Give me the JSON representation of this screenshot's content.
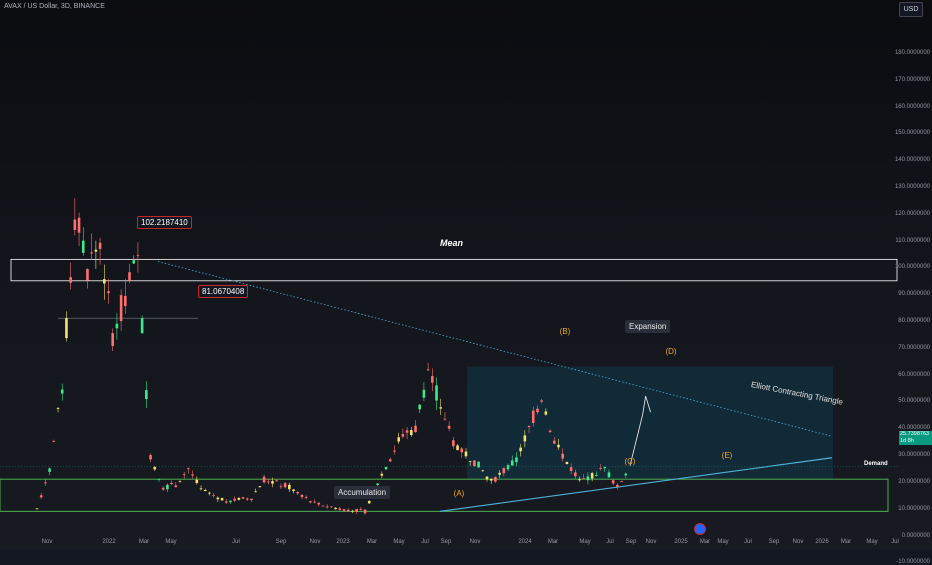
{
  "header": {
    "ticker": "AVAX / US Dollar, 3D, BINANCE",
    "currency": "USD"
  },
  "colors": {
    "bull": "#f5e36a",
    "bear": "#ff6f6f",
    "bull_alt": "#3ee88b",
    "demand_border": "#4caf50",
    "trend_line": "#4fb0d8",
    "expansion_fill": "#0e3a4a"
  },
  "annotations": {
    "peak_price": "102.2187410",
    "level_price": "81.0670408",
    "mean_label": "Mean",
    "demand_label": "Demand",
    "accumulation_label": "Accumulation",
    "expansion_label": "Expansion",
    "triangle_label": "Elliott Contracting Triangle",
    "wave_a": "(A)",
    "wave_b": "(B)",
    "wave_c": "(C)",
    "wave_d": "(D)",
    "wave_e": "(E)",
    "current_price": "25.7398763",
    "countdown": "1d 8h"
  },
  "chart_data": {
    "type": "candlestick",
    "title": "AVAX / US Dollar, 3D, BINANCE",
    "ylabel": "USD",
    "ylim": [
      -10,
      200
    ],
    "y_ticks": [
      "180.0000000",
      "170.0000000",
      "160.0000000",
      "150.0000000",
      "140.0000000",
      "130.0000000",
      "120.0000000",
      "110.0000000",
      "100.0000000",
      "90.0000000",
      "80.0000000",
      "70.0000000",
      "60.0000000",
      "50.0000000",
      "40.0000000",
      "30.0000000",
      "20.0000000",
      "10.0000000",
      "0.0000000",
      "-10.0000000"
    ],
    "y_values": [
      180,
      170,
      160,
      150,
      140,
      130,
      120,
      110,
      100,
      90,
      80,
      70,
      60,
      50,
      40,
      30,
      20,
      10,
      0,
      -10
    ],
    "x_ticks": [
      "Nov",
      "2022",
      "Mar",
      "May",
      "Jul",
      "Sep",
      "Nov",
      "2023",
      "Mar",
      "May",
      "Jul",
      "Sep",
      "Nov",
      "2024",
      "Mar",
      "May",
      "Jul",
      "Sep",
      "Nov",
      "2025",
      "Mar",
      "May",
      "Jul",
      "Sep",
      "Nov",
      "2026",
      "Mar",
      "May",
      "Jul"
    ],
    "price_path": [
      {
        "t": "2021-08",
        "p": 10
      },
      {
        "t": "2021-09",
        "p": 25
      },
      {
        "t": "2021-10",
        "p": 55
      },
      {
        "t": "2021-11",
        "p": 120
      },
      {
        "t": "2021-12",
        "p": 100
      },
      {
        "t": "2022-01",
        "p": 110
      },
      {
        "t": "2022-02",
        "p": 75
      },
      {
        "t": "2022-03",
        "p": 90
      },
      {
        "t": "2022-04",
        "p": 102
      },
      {
        "t": "2022-05",
        "p": 30
      },
      {
        "t": "2022-06",
        "p": 18
      },
      {
        "t": "2022-07",
        "p": 19
      },
      {
        "t": "2022-08",
        "p": 25
      },
      {
        "t": "2022-09",
        "p": 17
      },
      {
        "t": "2022-11",
        "p": 13
      },
      {
        "t": "2023-01",
        "p": 14
      },
      {
        "t": "2023-02",
        "p": 21
      },
      {
        "t": "2023-04",
        "p": 18
      },
      {
        "t": "2023-06",
        "p": 12
      },
      {
        "t": "2023-08",
        "p": 10
      },
      {
        "t": "2023-10",
        "p": 9
      },
      {
        "t": "2023-11",
        "p": 20
      },
      {
        "t": "2024-01",
        "p": 38
      },
      {
        "t": "2024-02",
        "p": 40
      },
      {
        "t": "2024-03",
        "p": 62
      },
      {
        "t": "2024-05",
        "p": 35
      },
      {
        "t": "2024-07",
        "p": 26
      },
      {
        "t": "2024-08",
        "p": 20
      },
      {
        "t": "2024-10",
        "p": 28
      },
      {
        "t": "2024-12",
        "p": 52
      },
      {
        "t": "2025-01",
        "p": 35
      },
      {
        "t": "2025-03",
        "p": 20
      },
      {
        "t": "2025-05",
        "p": 25
      },
      {
        "t": "2025-06",
        "p": 18
      },
      {
        "t": "2025-07",
        "p": 26
      }
    ],
    "projection": [
      {
        "t": "2025-07",
        "p": 26
      },
      {
        "t": "2025-08",
        "p": 45
      },
      {
        "t": "2025-08",
        "p": 52
      }
    ],
    "zones": {
      "mean": [
        95,
        103
      ],
      "demand": [
        9,
        21
      ],
      "expansion": [
        21,
        63
      ]
    },
    "levels": {
      "peak": 102.218741,
      "level": 81.0670408,
      "current": 25.7398763
    }
  }
}
